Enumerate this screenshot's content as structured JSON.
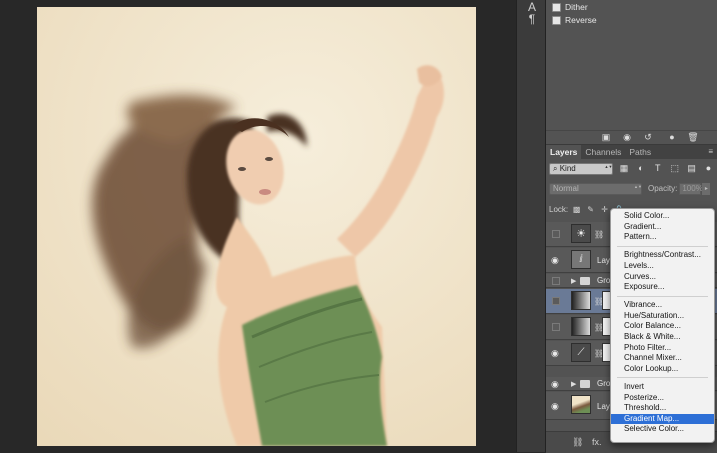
{
  "properties_panel": {
    "options": [
      {
        "label": "Dither",
        "checked": false
      },
      {
        "label": "Reverse",
        "checked": false
      }
    ]
  },
  "layers_panel": {
    "tabs": [
      "Layers",
      "Channels",
      "Paths"
    ],
    "active_tab": "Layers",
    "filter_kind": "Kind",
    "blend_mode": "Normal",
    "opacity_label": "Opacity:",
    "opacity_value": "100%",
    "lock_label": "Lock:",
    "layers": [
      {
        "type": "adjustment-exposure",
        "visible": false,
        "name": ""
      },
      {
        "type": "layer",
        "visible": true,
        "name": "Lay"
      },
      {
        "type": "group",
        "visible": false,
        "name": "Gro"
      },
      {
        "type": "adjustment-gradient",
        "visible": false,
        "name": "",
        "selected": true
      },
      {
        "type": "adjustment-gradient",
        "visible": false,
        "name": ""
      },
      {
        "type": "adjustment-curves",
        "visible": true,
        "name": ""
      },
      {
        "type": "group",
        "visible": true,
        "name": "Gro"
      },
      {
        "type": "photo",
        "visible": true,
        "name": "Laye"
      }
    ]
  },
  "context_menu": {
    "groups": [
      [
        "Solid Color...",
        "Gradient...",
        "Pattern..."
      ],
      [
        "Brightness/Contrast...",
        "Levels...",
        "Curves...",
        "Exposure..."
      ],
      [
        "Vibrance...",
        "Hue/Saturation...",
        "Color Balance...",
        "Black & White...",
        "Photo Filter...",
        "Channel Mixer...",
        "Color Lookup..."
      ],
      [
        "Invert",
        "Posterize...",
        "Threshold...",
        "Gradient Map...",
        "Selective Color..."
      ]
    ],
    "highlighted": "Gradient Map..."
  },
  "colors": {
    "menu_highlight": "#2d6fd6",
    "panel_bg": "#535353",
    "canvas_bg": "#282828"
  }
}
